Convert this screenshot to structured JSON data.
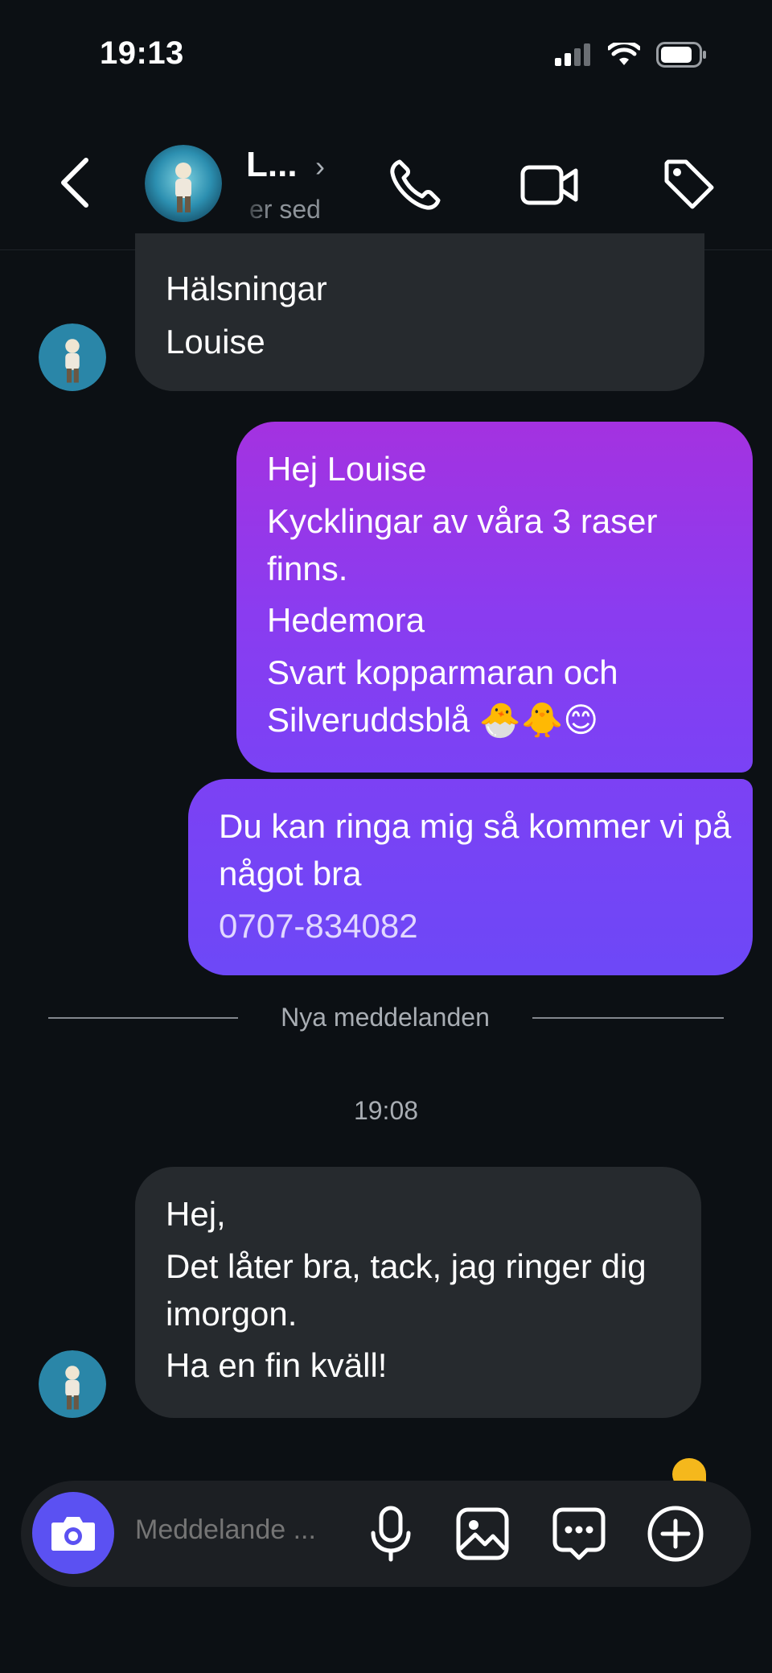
{
  "status_bar": {
    "time": "19:13"
  },
  "header": {
    "contact_name": "L...",
    "contact_status": "er sed"
  },
  "messages": [
    {
      "lines": [
        "Hälsningar",
        "Louise"
      ]
    },
    {
      "lines": [
        "Hej Louise",
        "Kycklingar av våra 3 raser finns.",
        "Hedemora",
        "Svart kopparmaran och Silveruddsblå 🐣🐥😊"
      ]
    },
    {
      "lines": [
        "Du kan ringa mig så kommer vi på något bra",
        "0707-834082"
      ]
    },
    {
      "lines": [
        "Hej,",
        "Det låter bra, tack, jag ringer dig imorgon.",
        "Ha en fin kväll!"
      ]
    }
  ],
  "divider": {
    "label": "Nya meddelanden"
  },
  "timestamp": "19:08",
  "composer": {
    "placeholder": "Meddelande ..."
  },
  "colors": {
    "background": "#0c1014",
    "received_bubble": "#262a2e",
    "sent_gradient_top": "#a432e0",
    "sent_gradient_bottom": "#6d48f7",
    "camera_button": "#5b51f2"
  },
  "icons": {
    "back": "chevron-left-icon",
    "call": "phone-icon",
    "video": "video-icon",
    "tag": "tag-icon",
    "camera": "camera-icon",
    "mic": "microphone-icon",
    "gallery": "image-icon",
    "sticker": "chat-bubble-icon",
    "add": "plus-circle-icon"
  }
}
